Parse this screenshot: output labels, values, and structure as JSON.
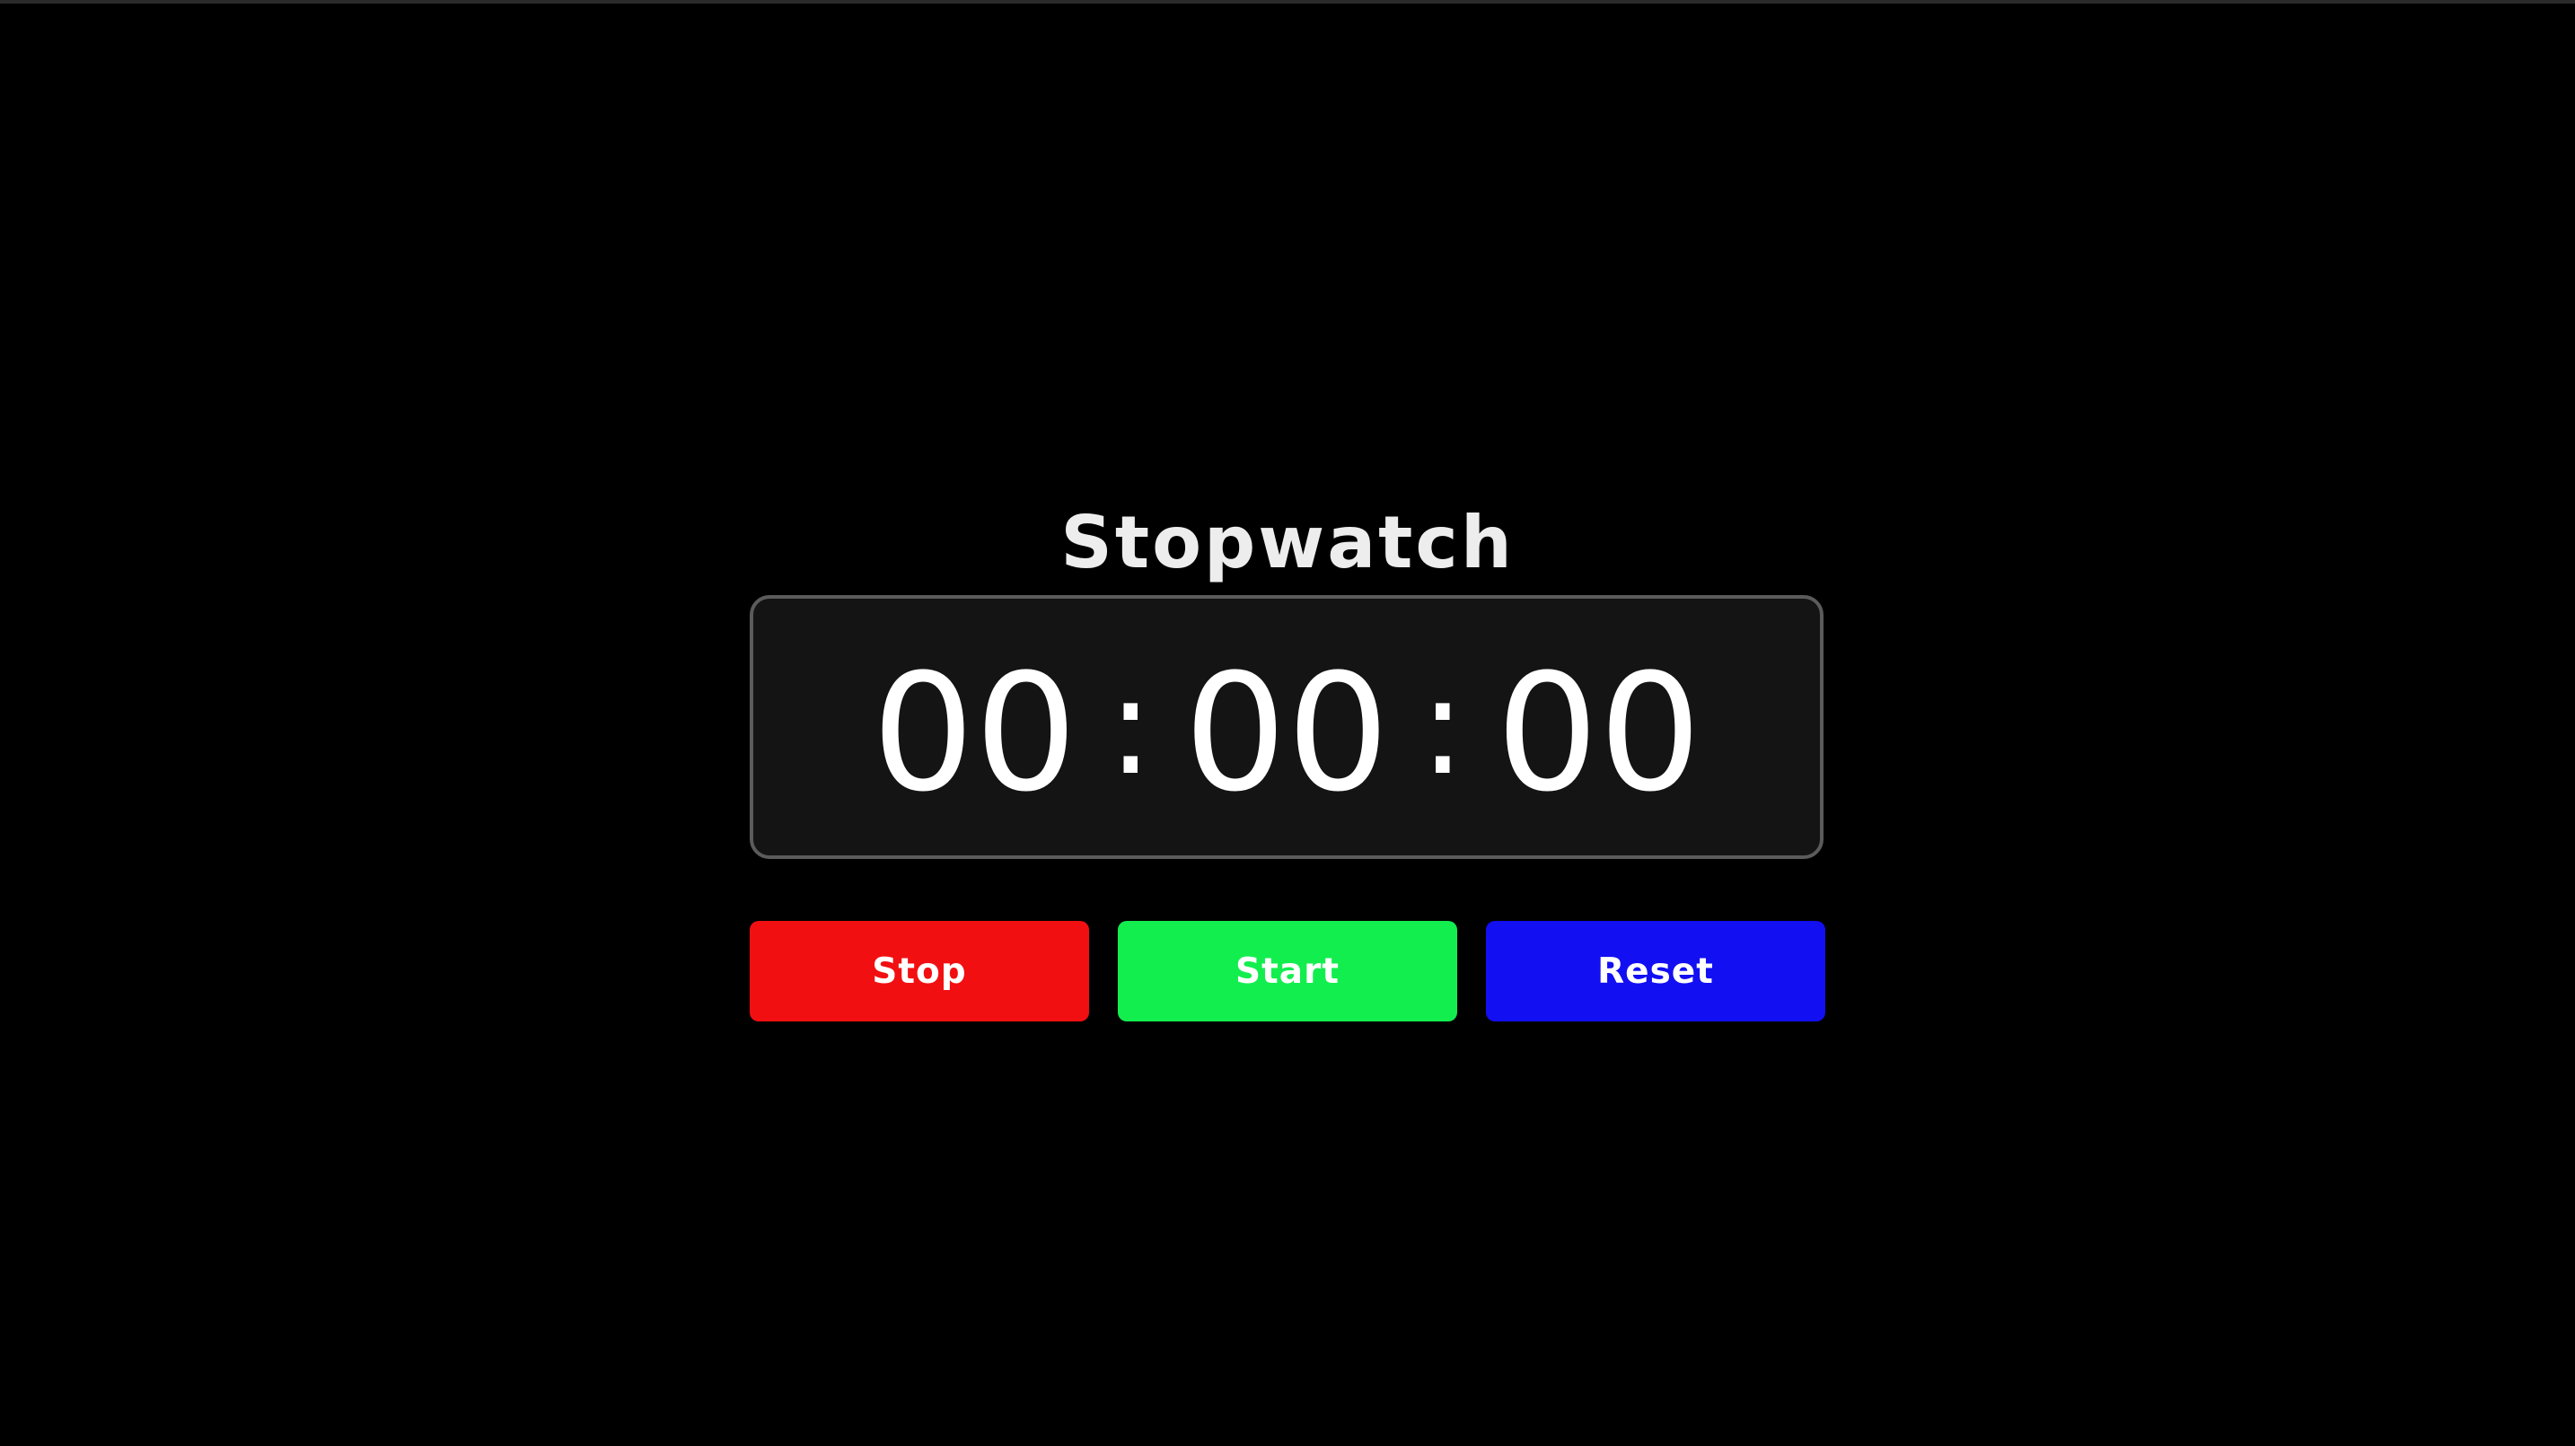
{
  "title": "Stopwatch",
  "timer": {
    "hours": "00",
    "separator_1": ":",
    "minutes": "00",
    "separator_2": ":",
    "seconds": "00"
  },
  "buttons": {
    "stop_label": "Stop",
    "start_label": "Start",
    "reset_label": "Reset"
  },
  "colors": {
    "background": "#000000",
    "display_background": "#141414",
    "display_border": "#5b5b5b",
    "stop": "#f20f11",
    "start": "#13ee4f",
    "reset": "#120ff2",
    "text": "#ffffff"
  }
}
